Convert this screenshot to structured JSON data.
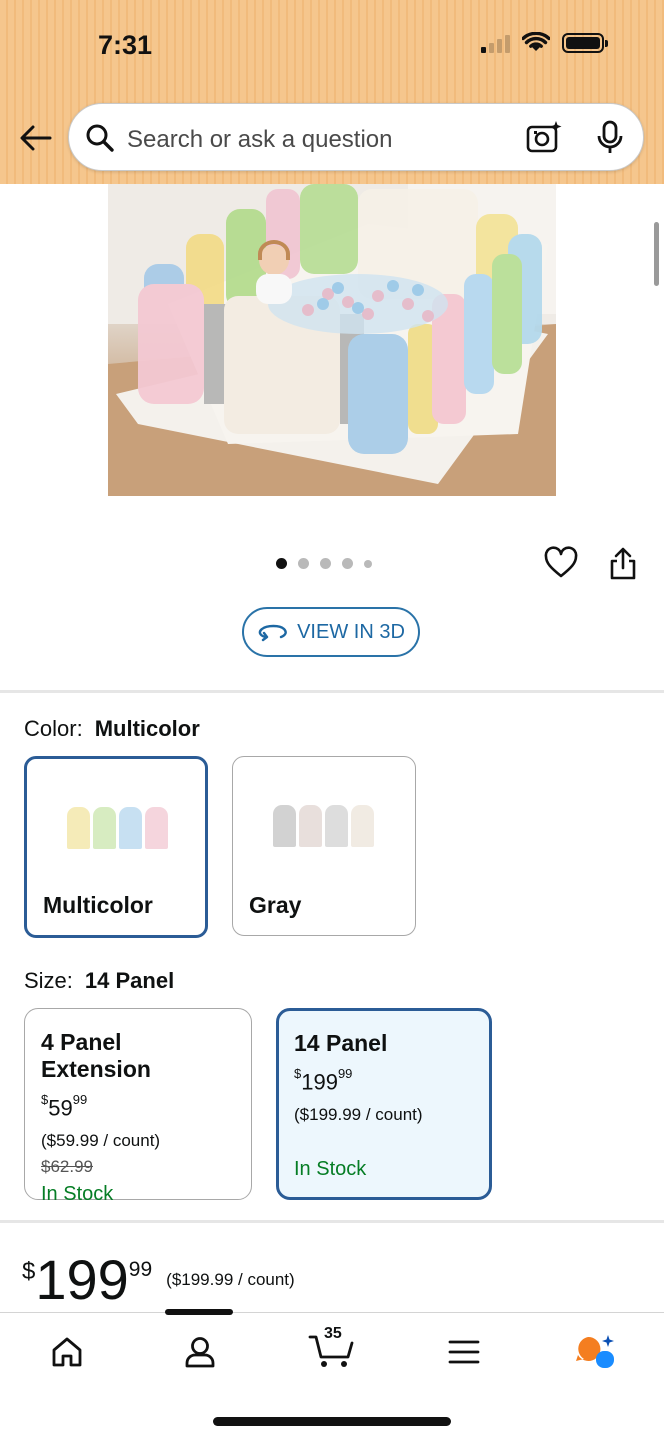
{
  "status_bar": {
    "time": "7:31"
  },
  "search": {
    "placeholder": "Search or ask a question"
  },
  "product": {
    "image_alt": "Colorful baby playpen with toddler and ball pit",
    "gallery_dots": 5,
    "gallery_active_index": 0,
    "view_3d_label": "VIEW IN 3D"
  },
  "color": {
    "label": "Color:",
    "selected": "Multicolor",
    "options": [
      {
        "name": "Multicolor",
        "selected": true
      },
      {
        "name": "Gray",
        "selected": false
      }
    ]
  },
  "size": {
    "label": "Size:",
    "selected": "14 Panel",
    "options": [
      {
        "title": "4 Panel Extension",
        "price_whole": "59",
        "price_fraction": "99",
        "unit_price": "($59.99 / count)",
        "was_price": "$62.99",
        "stock": "In Stock",
        "selected": false
      },
      {
        "title": "14 Panel",
        "price_whole": "199",
        "price_fraction": "99",
        "unit_price": "($199.99 / count)",
        "stock": "In Stock",
        "selected": true
      }
    ]
  },
  "price": {
    "symbol": "$",
    "whole": "199",
    "fraction": "99",
    "unit_price": "($199.99 / count)"
  },
  "bottom_nav": {
    "items": [
      "home-icon",
      "account-icon",
      "cart-icon",
      "menu-icon",
      "rufus-icon"
    ],
    "cart_count": "35",
    "active_index": 1
  },
  "colors": {
    "accent_blue": "#2b5c96",
    "link_blue": "#1d68a3",
    "stock_green": "#067d25",
    "header_orange": "#f5c68d",
    "rufus_orange": "#f47e20",
    "rufus_blue": "#1a8cff"
  }
}
